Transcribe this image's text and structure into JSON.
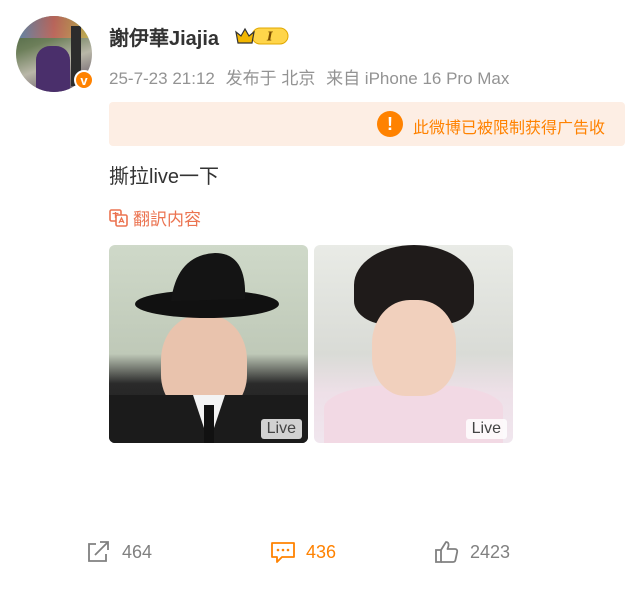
{
  "user": {
    "name": "謝伊華Jiajia",
    "verified_mark": "v",
    "member_level": "I"
  },
  "meta": {
    "timestamp": "25-7-23 21:12",
    "location": "发布于 北京",
    "source": "来自 iPhone 16 Pro Max"
  },
  "notice": {
    "icon": "warning-icon",
    "text": "此微博已被限制获得广告收"
  },
  "post": {
    "text": "撕拉live一下",
    "translate_label": "翻訳内容"
  },
  "media": [
    {
      "badge": "Live"
    },
    {
      "badge": "Live"
    }
  ],
  "actions": {
    "share_count": "464",
    "comment_count": "436",
    "like_count": "2423"
  },
  "colors": {
    "accent": "#ff8200",
    "translate": "#eb7350",
    "notice_bg": "#fdeee4",
    "meta_text": "#939393"
  }
}
